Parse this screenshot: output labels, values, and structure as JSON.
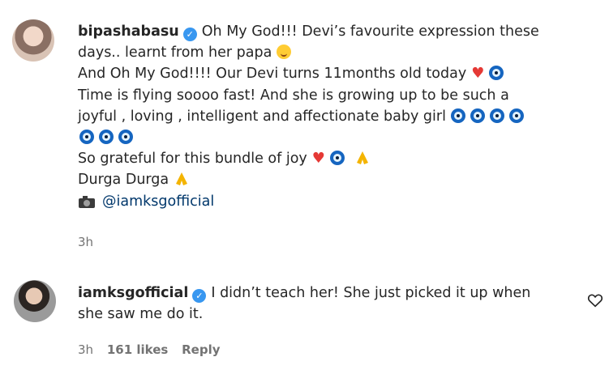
{
  "comments": [
    {
      "username": "bipashabasu",
      "lines": [
        "Oh My God!!! Devi’s favourite expression these",
        "days.. learnt from her papa",
        "And Oh My God!!!! Our Devi turns 11months old today",
        "Time is flying soooo fast! And she is growing up to be such a",
        "joyful , loving , intelligent and affectionate baby girl",
        "",
        "So grateful for this bundle of joy",
        "Durga Durga",
        "@iamksgofficial"
      ],
      "time": "3h"
    },
    {
      "username": "iamksgofficial",
      "lines": [
        "I didn’t teach her! She just picked it up when",
        "she saw me do it."
      ],
      "time": "3h",
      "likes": "161 likes",
      "reply": "Reply"
    }
  ],
  "icons": {
    "verified": "verified-badge-icon",
    "like": "heart-outline-icon",
    "emoji_eye": "evil-eye-emoji-icon",
    "emoji_heart": "red-heart-emoji-icon",
    "emoji_pray": "folded-hands-emoji-icon",
    "emoji_smile": "laughing-face-emoji-icon",
    "emoji_camera": "camera-emoji-icon"
  },
  "colors": {
    "verified_blue": "#3897f0",
    "mention": "#00376b",
    "muted": "#737373"
  }
}
